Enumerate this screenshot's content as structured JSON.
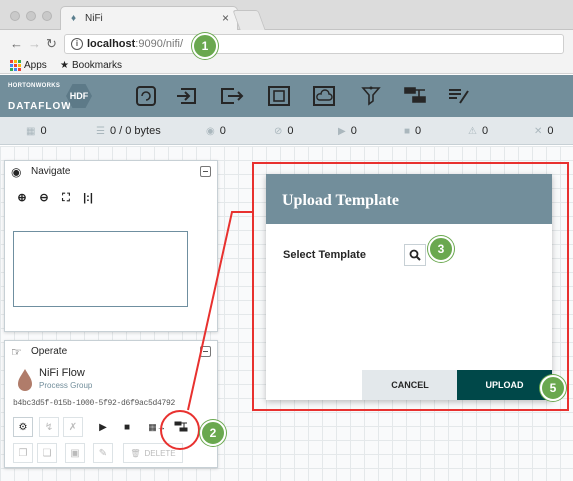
{
  "browser": {
    "tab_title": "NiFi",
    "tab_close": "×",
    "url_host": "localhost",
    "url_rest": ":9090/nifi/",
    "bookmarks": [
      {
        "label": "Apps",
        "icon": "apps-grid-icon"
      },
      {
        "label": "Bookmarks",
        "icon": "star-icon"
      }
    ]
  },
  "header": {
    "logo_top": "HORTONWORKS",
    "logo_bottom": "DATAFLOW",
    "badge": "HDF",
    "toolbar_icons": [
      "processor-icon",
      "input-port-icon",
      "output-port-icon",
      "process-group-icon",
      "remote-process-group-icon",
      "funnel-icon",
      "template-icon",
      "label-icon"
    ]
  },
  "status": [
    {
      "icon": "cluster-icon",
      "value": "0"
    },
    {
      "icon": "queue-icon",
      "value": "0 / 0 bytes"
    },
    {
      "icon": "transmitting-icon",
      "value": "0"
    },
    {
      "icon": "not-transmitting-icon",
      "value": "0"
    },
    {
      "icon": "running-icon",
      "value": "0"
    },
    {
      "icon": "stopped-icon",
      "value": "0"
    },
    {
      "icon": "invalid-icon",
      "value": "0"
    },
    {
      "icon": "disabled-icon",
      "value": "0"
    }
  ],
  "navigate": {
    "title": "Navigate"
  },
  "operate": {
    "title": "Operate",
    "flow_name": "NiFi Flow",
    "flow_type": "Process Group",
    "flow_id": "b4bc3d5f-015b-1000-5f92-d6f9ac5d4792",
    "delete_label": "DELETE"
  },
  "dialog": {
    "title": "Upload Template",
    "select_label": "Select Template",
    "cancel_label": "CANCEL",
    "upload_label": "UPLOAD"
  },
  "steps": [
    "1",
    "2",
    "3",
    "5"
  ],
  "colors": {
    "nifi_header": "#728e9b",
    "upload_button": "#004849",
    "step_marker": "#6aa84f",
    "highlight": "#e8312f"
  }
}
